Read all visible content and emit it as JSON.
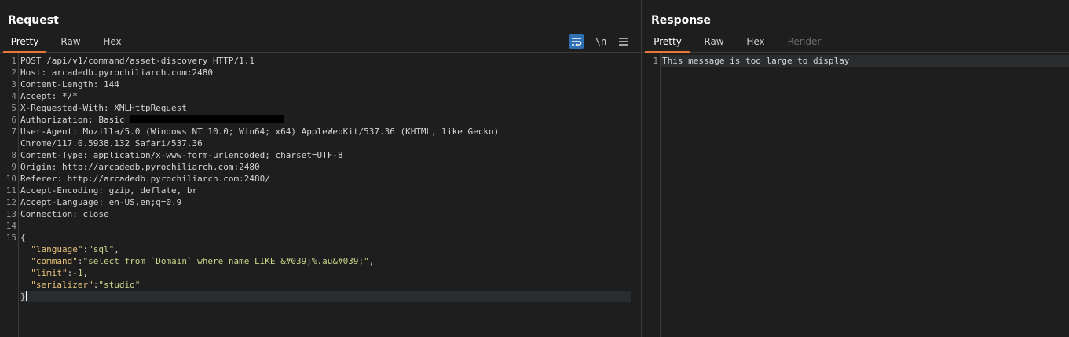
{
  "request": {
    "title": "Request",
    "tabs": [
      "Pretty",
      "Raw",
      "Hex"
    ],
    "active_tab": "Pretty",
    "toolbar": {
      "newline_label": "\\n"
    },
    "headers": [
      {
        "num": "1",
        "text": "POST /api/v1/command/asset-discovery HTTP/1.1"
      },
      {
        "num": "2",
        "text": "Host: arcadedb.pyrochiliarch.com:2480"
      },
      {
        "num": "3",
        "text": "Content-Length: 144"
      },
      {
        "num": "4",
        "text": "Accept: */*"
      },
      {
        "num": "5",
        "text": "X-Requested-With: XMLHttpRequest"
      },
      {
        "num": "6",
        "text": "Authorization: Basic "
      },
      {
        "num": "7",
        "text": "User-Agent: Mozilla/5.0 (Windows NT 10.0; Win64; x64) AppleWebKit/537.36 (KHTML, like Gecko)"
      },
      {
        "num": "",
        "text": "Chrome/117.0.5938.132 Safari/537.36"
      },
      {
        "num": "8",
        "text": "Content-Type: application/x-www-form-urlencoded; charset=UTF-8"
      },
      {
        "num": "9",
        "text": "Origin: http://arcadedb.pyrochiliarch.com:2480"
      },
      {
        "num": "10",
        "text": "Referer: http://arcadedb.pyrochiliarch.com:2480/"
      },
      {
        "num": "11",
        "text": "Accept-Encoding: gzip, deflate, br"
      },
      {
        "num": "12",
        "text": "Accept-Language: en-US,en;q=0.9"
      },
      {
        "num": "13",
        "text": "Connection: close"
      },
      {
        "num": "14",
        "text": ""
      }
    ],
    "body": {
      "num_open": "15",
      "open": "{",
      "close": "}",
      "fields": [
        {
          "key": "\"language\"",
          "value": "\"sql\"",
          "suffix": ","
        },
        {
          "key": "\"command\"",
          "value": "\"select from `Domain` where name LIKE &#039;%.au&#039;\"",
          "suffix": ","
        },
        {
          "key": "\"limit\"",
          "value": "-1",
          "suffix": ","
        },
        {
          "key": "\"serializer\"",
          "value": "\"studio\"",
          "suffix": ""
        }
      ]
    }
  },
  "response": {
    "title": "Response",
    "tabs": [
      "Pretty",
      "Raw",
      "Hex",
      "Render"
    ],
    "active_tab": "Pretty",
    "disabled_tabs": [
      "Render"
    ],
    "lines": [
      {
        "num": "1",
        "text": "This message is too large to display"
      }
    ]
  },
  "colors": {
    "background": "#1e1e1e",
    "active_tab_underline": "#e8773a",
    "json_key": "#e6c27a",
    "json_value": "#cbd38a",
    "wrap_button": "#2f6fb3"
  }
}
